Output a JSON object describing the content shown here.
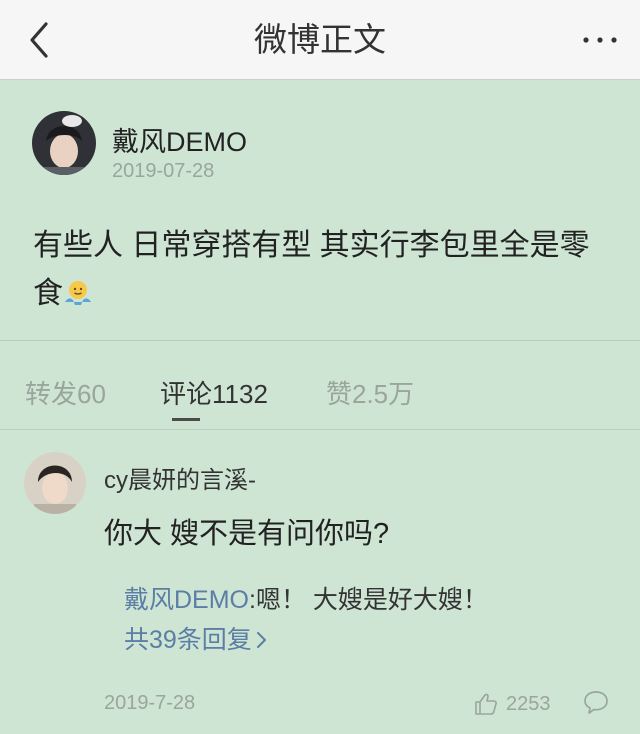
{
  "navbar": {
    "title": "微博正文",
    "back_icon": "chevron-left-icon",
    "more_icon": "more-dots-icon"
  },
  "post": {
    "author": "戴风DEMO",
    "date": "2019-07-28",
    "text": "有些人 日常穿搭有型 其实行李包里全是零食",
    "emoji_icon": "shrug-emoji-icon"
  },
  "tabs": [
    {
      "label": "转发60"
    },
    {
      "label": "评论1132"
    },
    {
      "label": "赞2.5万"
    }
  ],
  "comment": {
    "user": "cy晨妍的言溪-",
    "text": "你大 嫂不是有问你吗?",
    "reply": {
      "author": "戴风DEMO",
      "separator": ":",
      "text": "嗯！ 大嫂是好大嫂！",
      "more_label": "共39条回复"
    },
    "date": "2019-7-28",
    "like_count": "2253",
    "like_icon": "thumbs-up-icon",
    "reply_icon": "comment-bubble-icon"
  },
  "colors": {
    "background": "#cfe5d4",
    "navbar": "#f6f6f6",
    "link": "#5b7ea6",
    "muted": "#9aa59c"
  }
}
